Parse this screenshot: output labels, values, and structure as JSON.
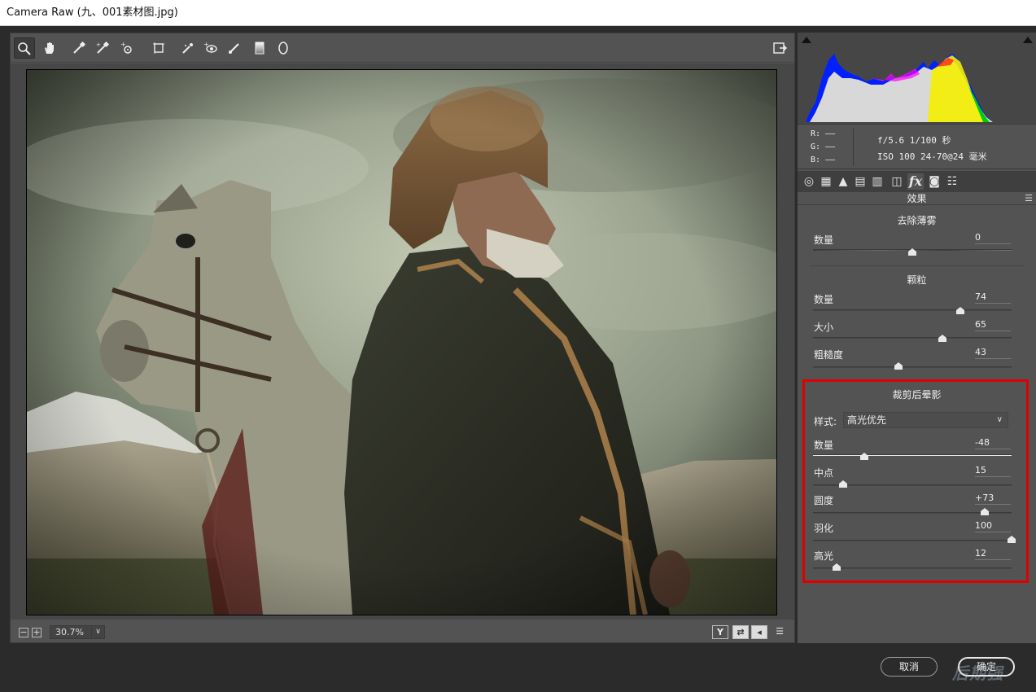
{
  "window": {
    "title": "Camera Raw (九、001素材图.jpg)"
  },
  "toolbar": {
    "tools": [
      {
        "name": "zoom-tool-icon",
        "glyph": "🔍"
      },
      {
        "name": "hand-tool-icon",
        "glyph": "✋"
      },
      {
        "name": "white-balance-tool-icon",
        "glyph": "⁄"
      },
      {
        "name": "color-sampler-tool-icon",
        "glyph": "⁄"
      },
      {
        "name": "targeted-adjustment-tool-icon",
        "glyph": "⊙"
      },
      {
        "name": "transform-tool-icon",
        "glyph": "⊞"
      },
      {
        "name": "spot-removal-tool-icon",
        "glyph": "⁄"
      },
      {
        "name": "red-eye-tool-icon",
        "glyph": "◉"
      },
      {
        "name": "adjustment-brush-icon",
        "glyph": "⁄"
      },
      {
        "name": "graduated-filter-icon",
        "glyph": "▮"
      },
      {
        "name": "radial-filter-icon",
        "glyph": "○"
      }
    ]
  },
  "zoom": {
    "value": "30.7%"
  },
  "camera_info": {
    "r": "R:",
    "g": "G:",
    "b": "B:",
    "r_value": "——",
    "g_value": "——",
    "b_value": "——",
    "line1": "f/5.6  1/100 秒",
    "line2": "ISO 100  24-70@24 毫米"
  },
  "panel": {
    "title": "效果",
    "dehaze": {
      "title": "去除薄雾",
      "amount_label": "数量",
      "amount_value": "0",
      "amount": 0
    },
    "grain": {
      "title": "颗粒",
      "amount_label": "数量",
      "amount_value": "74",
      "amount": 74,
      "size_label": "大小",
      "size_value": "65",
      "size": 65,
      "roughness_label": "粗糙度",
      "roughness_value": "43",
      "roughness": 43
    },
    "vignette": {
      "title": "裁剪后晕影",
      "style_label": "样式:",
      "style_value": "高光优先",
      "amount_label": "数量",
      "amount_value": "-48",
      "amount": -48,
      "midpoint_label": "中点",
      "midpoint_value": "15",
      "midpoint": 15,
      "roundness_label": "圆度",
      "roundness_value": "+73",
      "roundness": 73,
      "feather_label": "羽化",
      "feather_value": "100",
      "feather": 100,
      "highlights_label": "高光",
      "highlights_value": "12",
      "highlights": 12
    }
  },
  "footer": {
    "cancel_label": "取消",
    "ok_label": "确定",
    "watermark": "后期强"
  }
}
